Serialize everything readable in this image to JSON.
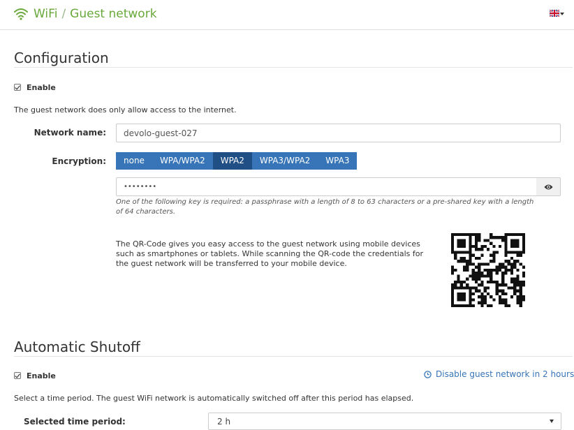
{
  "header": {
    "breadcrumb_root": "WiFi",
    "breadcrumb_separator": "/",
    "breadcrumb_current": "Guest network",
    "wifi_icon": "wifi-icon",
    "language_icon": "uk-flag-icon",
    "accent_color": "#69a83a"
  },
  "configuration": {
    "title": "Configuration",
    "enable_label": "Enable",
    "enable_checked": true,
    "info_text": "The guest network does only allow access to the internet.",
    "network_name_label": "Network name:",
    "network_name_value": "devolo-guest-027",
    "encryption_label": "Encryption:",
    "encryption_options": [
      "none",
      "WPA/WPA2",
      "WPA2",
      "WPA3/WPA2",
      "WPA3"
    ],
    "encryption_selected": "WPA2",
    "key_value": "••••••••",
    "key_hint": "One of the following key is required: a passphrase with a length of 8 to 63 characters or a pre-shared key with a length of 64 characters.",
    "qr_text": "The QR-Code gives you easy access to the guest network using mobile devices such as smartphones or tablets. While scanning the QR-code the credentials for the guest network will be transferred to your mobile device.",
    "button_color": "#3775b8",
    "button_active_color": "#1f4f85"
  },
  "shutoff": {
    "title": "Automatic Shutoff",
    "enable_label": "Enable",
    "enable_checked": true,
    "disable_link": "Disable guest network in 2 hours",
    "info_text": "Select a time period. The guest WiFi network is automatically switched off after this period has elapsed.",
    "period_label": "Selected time period:",
    "period_value": "2 h"
  }
}
